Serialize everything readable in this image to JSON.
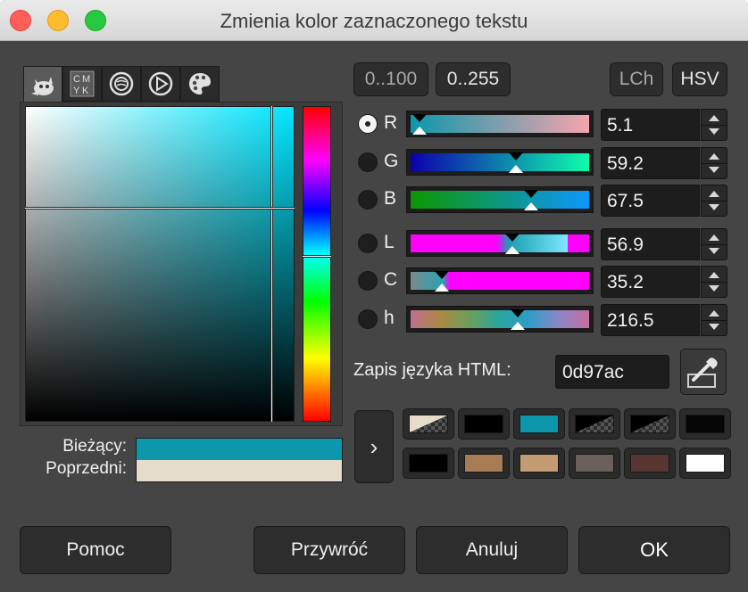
{
  "window": {
    "title": "Zmienia kolor zaznaczonego tekstu"
  },
  "tabs": [
    {
      "name": "gimp-wilber-icon",
      "active": true
    },
    {
      "name": "cmyk-icon",
      "label": "CMYK"
    },
    {
      "name": "watercolor-icon"
    },
    {
      "name": "wheel-triangle-icon"
    },
    {
      "name": "palette-icon"
    }
  ],
  "range_buttons": {
    "range_100": "0..100",
    "range_255": "0..255"
  },
  "mode_buttons": {
    "lch": "LCh",
    "hsv": "HSV"
  },
  "channels": [
    {
      "label": "R",
      "value": "5.1",
      "checked": true,
      "fraction": 0.051
    },
    {
      "label": "G",
      "value": "59.2",
      "checked": false,
      "fraction": 0.592
    },
    {
      "label": "B",
      "value": "67.5",
      "checked": false,
      "fraction": 0.675
    },
    {
      "label": "L",
      "value": "56.9",
      "checked": false,
      "fraction": 0.569
    },
    {
      "label": "C",
      "value": "35.2",
      "checked": false,
      "fraction": 0.176
    },
    {
      "label": "h",
      "value": "216.5",
      "checked": false,
      "fraction": 0.601
    }
  ],
  "html_notation": {
    "label": "Zapis języka HTML:",
    "value": "0d97ac"
  },
  "current_previous": {
    "current_label": "Bieżący:",
    "previous_label": "Poprzedni:",
    "current_color": "#0d97ac",
    "previous_color": "#e6dccb"
  },
  "history": {
    "expand_glyph": "›",
    "row1": [
      "checker-beige",
      "#000000",
      "#0d97ac",
      "checker-black",
      "checker-black",
      "#050505"
    ],
    "row2": [
      "#000000",
      "#a87c55",
      "#c49c74",
      "#6b605c",
      "#5a3632",
      "#ffffff"
    ]
  },
  "buttons": {
    "help": "Pomoc",
    "reset": "Przywróć",
    "cancel": "Anuluj",
    "ok": "OK"
  }
}
